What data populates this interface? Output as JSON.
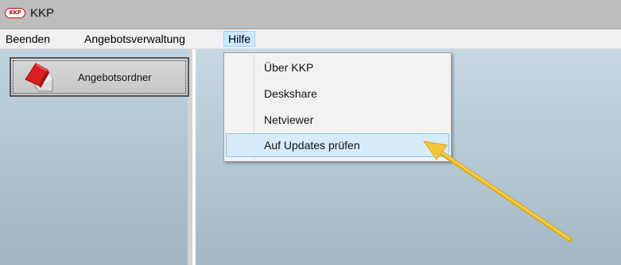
{
  "window": {
    "logo_text": "KKP",
    "title": "KKP"
  },
  "menubar": {
    "items": [
      "Beenden",
      "Angebotsverwaltung",
      "Hilfe"
    ],
    "active": "Hilfe"
  },
  "sidebar": {
    "button_label": "Angebotsordner",
    "button_icon": "house-icon"
  },
  "help_menu": {
    "items": [
      "Über KKP",
      "Deskshare",
      "Netviewer",
      "Auf Updates prüfen"
    ],
    "highlighted": "Auf Updates prüfen"
  },
  "annotation": {
    "type": "arrow",
    "color": "#f2c637",
    "points_to": "Auf Updates prüfen"
  }
}
